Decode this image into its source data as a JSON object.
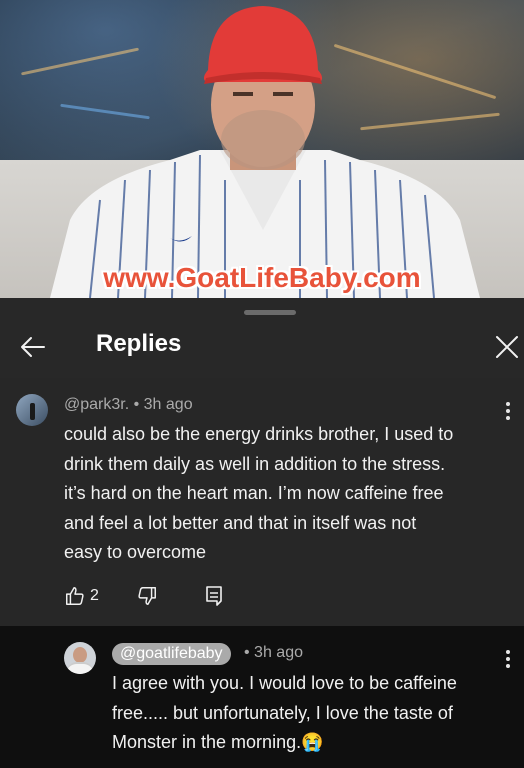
{
  "video": {
    "overlay_url": "www.GoatLifeBaby.com"
  },
  "panel": {
    "title": "Replies"
  },
  "comment": {
    "author": "@park3r.",
    "time": "3h ago",
    "text": "could also be the energy drinks brother, I used to\ndrink them daily as well in addition to the stress.\nit’s hard on the heart man. I’m now caffeine free\nand feel a lot better and that in itself was not\neasy to overcome",
    "likes": "2"
  },
  "reply": {
    "author": "@goatlifebaby",
    "time": "3h ago",
    "text": "I agree with you. I would love to be caffeine\nfree..... but unfortunately, I love the taste of\nMonster in the morning.😭"
  },
  "icons": {
    "back": "arrow-left-icon",
    "close": "close-icon",
    "more": "more-vert-icon",
    "like": "thumb-up-icon",
    "dislike": "thumb-down-icon",
    "reply": "reply-icon"
  },
  "colors": {
    "panel_bg": "#282828",
    "reply_bg": "#0f0f0f",
    "meta_text": "#aaaaaa",
    "url_text": "#e8533a"
  }
}
